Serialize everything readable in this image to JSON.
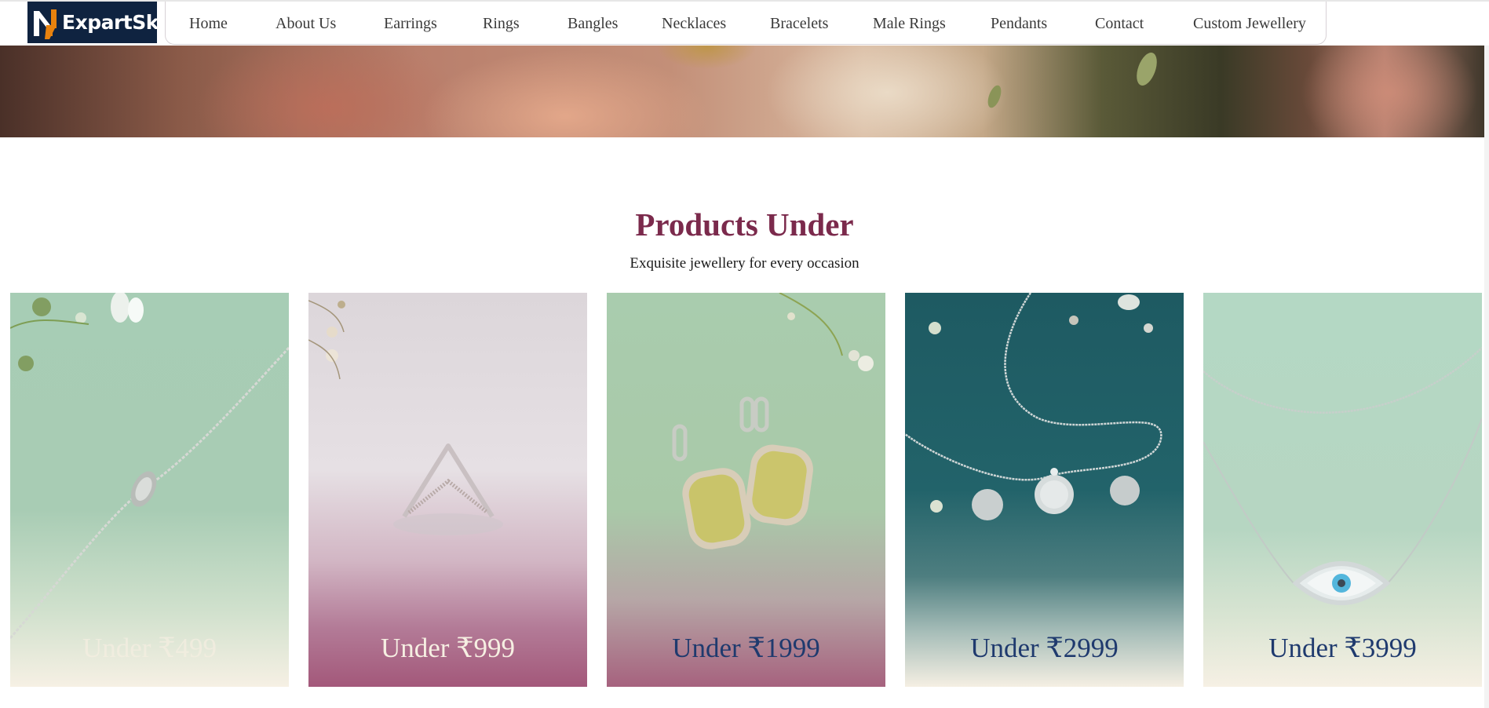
{
  "brand": {
    "name": "ExpartSky",
    "logo_icon": "n-mark-icon",
    "colors": {
      "logo_bg": "#0f2340",
      "logo_accent": "#e8820e",
      "title": "#7b2a4c",
      "label_dark": "#1f3a6e",
      "label_light": "#f6efe2"
    }
  },
  "nav": {
    "items": [
      {
        "label": "Home"
      },
      {
        "label": "About Us"
      },
      {
        "label": "Earrings"
      },
      {
        "label": "Rings"
      },
      {
        "label": "Bangles"
      },
      {
        "label": "Necklaces"
      },
      {
        "label": "Bracelets"
      },
      {
        "label": "Male Rings"
      },
      {
        "label": "Pendants"
      },
      {
        "label": "Contact"
      },
      {
        "label": "Custom Jewellery"
      }
    ]
  },
  "section": {
    "title": "Products Under",
    "subtitle": "Exquisite jewellery for every occasion"
  },
  "cards": [
    {
      "label": "Under ₹499",
      "image": "bracelet-on-green-paper"
    },
    {
      "label": "Under ₹999",
      "image": "chevron-ring-on-pink"
    },
    {
      "label": "Under ₹1999",
      "image": "yellow-gem-earrings-on-green"
    },
    {
      "label": "Under ₹2999",
      "image": "diamond-pendant-set-on-teal"
    },
    {
      "label": "Under ₹3999",
      "image": "evil-eye-layered-necklace"
    }
  ]
}
